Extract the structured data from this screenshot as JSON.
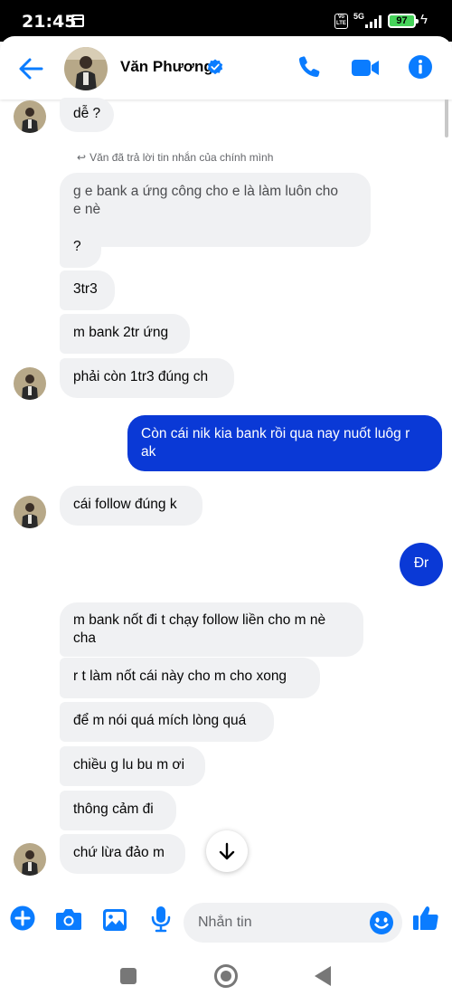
{
  "status_bar": {
    "time": "21:45",
    "network": "5G",
    "battery": "97"
  },
  "header": {
    "contact_name": "Văn Phương",
    "accent_color": "#0a7cff"
  },
  "messages": {
    "partial_top": "dễ ?",
    "reply_note": "Văn đã trả lời tin nhắn của chính mình",
    "m1_line1": "g e bank a ứng công cho e là làm luôn cho",
    "m1_line2": "e nè",
    "m2": "?",
    "m3": "3tr3",
    "m4": "m bank 2tr ứng",
    "m5": "phải còn 1tr3 đúng ch",
    "m6_line1": "Còn cái nik kia bank rồi qua nay nuốt luôg r",
    "m6_line2": "ak",
    "m7": "cái follow đúng k",
    "m8": "Đr",
    "m9_line1": "m bank nốt đi t chạy follow liền cho m nè",
    "m9_line2": "cha",
    "m10": "r t làm nốt cái này cho m cho xong",
    "m11": "để m nói quá mích lòng quá",
    "m12": "chiều g lu bu m ơi",
    "m13": "thông cảm đi",
    "m14": "chứ lừa đảo m"
  },
  "composer": {
    "placeholder": "Nhắn tin"
  },
  "colors": {
    "outgoing_bubble": "#0a39d6",
    "incoming_bubble": "#f0f1f3",
    "icon_blue": "#0a7cff"
  }
}
